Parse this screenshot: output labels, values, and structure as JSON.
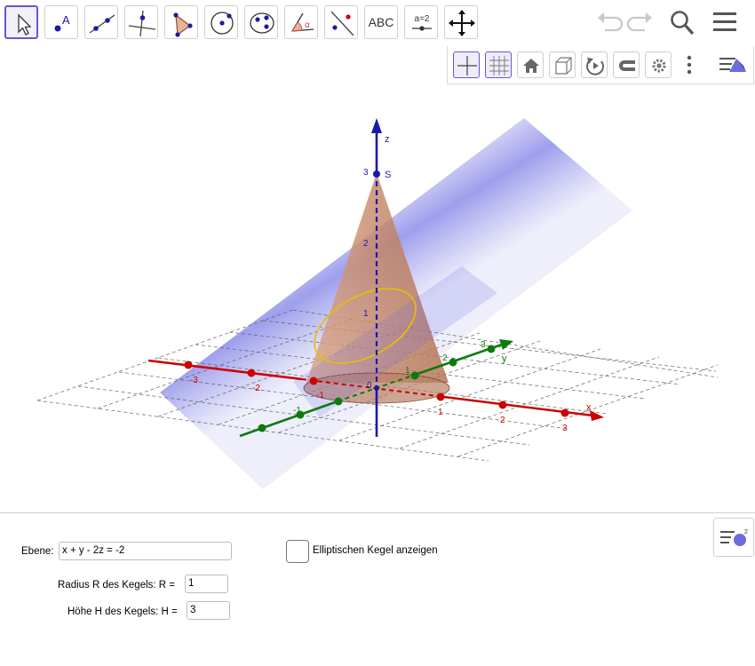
{
  "toolbar": {
    "tools": [
      {
        "icon": "move-arrow-icon"
      },
      {
        "icon": "point-icon",
        "glyph": "A"
      },
      {
        "icon": "line-icon"
      },
      {
        "icon": "perpendicular-line-icon"
      },
      {
        "icon": "polygon-icon"
      },
      {
        "icon": "circle-with-axis-icon"
      },
      {
        "icon": "intersect-conics-icon"
      },
      {
        "icon": "angle-icon",
        "glyph": "α"
      },
      {
        "icon": "reflect-point-icon"
      },
      {
        "icon": "text-icon",
        "label": "ABC"
      },
      {
        "icon": "slider-icon",
        "label": "a=2"
      },
      {
        "icon": "move-view-icon"
      }
    ],
    "right": [
      "undo-icon",
      "redo-icon",
      "search-icon",
      "menu-icon"
    ]
  },
  "stylebar": {
    "buttons": [
      "axes-icon",
      "grid-icon",
      "home-icon",
      "cube-view-icon",
      "rotate-view-icon",
      "glasses-icon",
      "settings-icon",
      "more-icon",
      "view-toggle-icon"
    ]
  },
  "view3d": {
    "axis_labels": {
      "x": "x",
      "y": "y",
      "z": "z"
    },
    "point_label": "S",
    "tick_labels": {
      "x": [
        "-3",
        "-2",
        "-1",
        "1",
        "2",
        "3"
      ],
      "y": [
        "-1",
        "1",
        "2",
        "3"
      ],
      "z": [
        "1",
        "2",
        "3"
      ],
      "origin": "0"
    },
    "colors": {
      "x_axis": "#cc0000",
      "y_axis": "#0c7a0c",
      "z_axis": "#1a1aa8",
      "cone_fill": "#c98a66",
      "plane_fill": "#6e6ee0",
      "ellipse": "#e8c400"
    }
  },
  "inputs": {
    "ebene": {
      "label": "Ebene:",
      "value": "x + y - 2z = -2"
    },
    "radius": {
      "label": "Radius R des Kegels: R =",
      "value": "1"
    },
    "hoehe": {
      "label": "Höhe H des Kegels: H =",
      "value": "3"
    },
    "checkbox": {
      "label": "Elliptischen Kegel anzeigen",
      "checked": false
    }
  }
}
